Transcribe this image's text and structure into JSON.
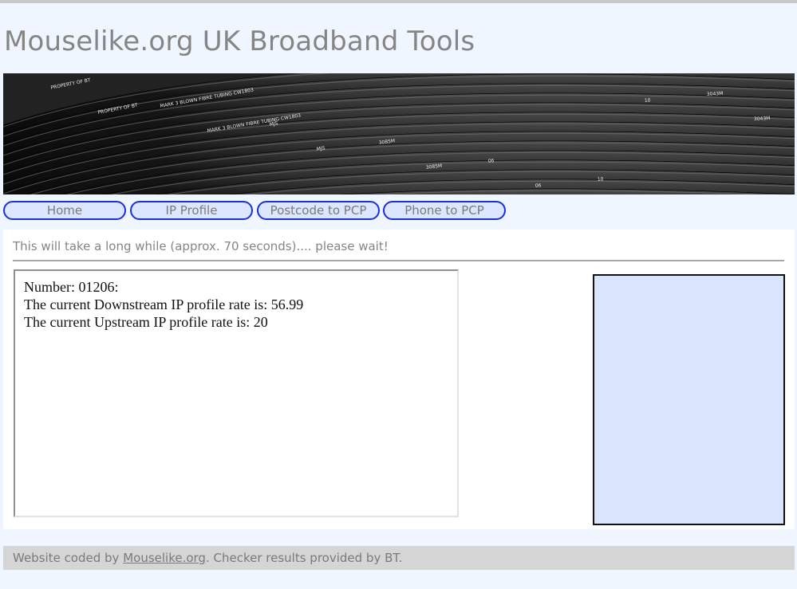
{
  "header": {
    "title": "Mouselike.org UK Broadband Tools"
  },
  "banner": {
    "cable_text": [
      "PROPERTY OF BT",
      "MARK 3 BLOWN FIBRE TUBING CW1803",
      "MJS",
      "3085M",
      "06",
      "10",
      "3043M"
    ]
  },
  "nav": [
    {
      "label": "Home"
    },
    {
      "label": "IP Profile"
    },
    {
      "label": "Postcode to PCP"
    },
    {
      "label": "Phone to PCP"
    }
  ],
  "main": {
    "wait_message": "This will take a long while (approx. 70 seconds).... please wait!",
    "results": [
      "Number: 01206:",
      "The current Downstream IP profile rate is: 56.99",
      "The current Upstream IP profile rate is: 20"
    ]
  },
  "footer": {
    "prefix": "Website coded by ",
    "link": "Mouselike.org",
    "suffix": ". Checker results provided by BT."
  },
  "colors": {
    "page_bg": "#f0f6ff",
    "nav_border": "#1a2fd6",
    "nav_bg": "#dde6ff",
    "side_box_bg": "#d8e5fc",
    "footer_bg": "#d5d5d5"
  }
}
